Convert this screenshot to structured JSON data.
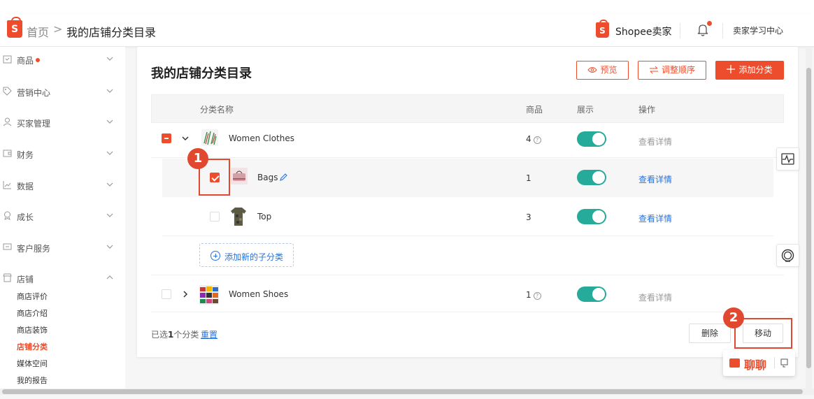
{
  "header": {
    "logo_letter": "S",
    "home": "首页",
    "separator": ">",
    "current": "我的店铺分类目录",
    "seller_logo_letter": "S",
    "seller_name": "Shopee卖家",
    "learning_center": "卖家学习中心",
    "icons": [
      "bell-icon"
    ]
  },
  "sidebar": {
    "items": [
      {
        "label": "商品",
        "icon": "product-icon",
        "has_dot": true
      },
      {
        "label": "营销中心",
        "icon": "tag-icon"
      },
      {
        "label": "买家管理",
        "icon": "user-icon"
      },
      {
        "label": "财务",
        "icon": "wallet-icon"
      },
      {
        "label": "数据",
        "icon": "chart-icon"
      },
      {
        "label": "成长",
        "icon": "badge-icon"
      },
      {
        "label": "客户服务",
        "icon": "message-icon"
      },
      {
        "label": "店铺",
        "icon": "shop-icon"
      }
    ],
    "shop_sub": [
      "商店评价",
      "商店介绍",
      "商店装饰",
      "店铺分类",
      "媒体空间",
      "我的报告"
    ],
    "active_sub": "店铺分类"
  },
  "main": {
    "title": "我的店铺分类目录",
    "buttons": {
      "preview": "预览",
      "reorder": "调整顺序",
      "add": "添加分类"
    },
    "columns": {
      "name": "分类名称",
      "products": "商品",
      "display": "展示",
      "actions": "操作"
    },
    "rows": [
      {
        "name": "Women Clothes",
        "count": "4",
        "count_help": "?",
        "display": true,
        "action": "查看详情",
        "checked": "partial",
        "expanded": true
      },
      {
        "name": "Bags",
        "count": "1",
        "display": true,
        "action": "查看详情",
        "checked": true
      },
      {
        "name": "Top",
        "count": "3",
        "display": true,
        "action": "查看详情",
        "checked": false
      },
      {
        "name": "Women Shoes",
        "count": "1",
        "count_help": "?",
        "display": true,
        "action": "查看详情",
        "checked": false,
        "expanded": false
      }
    ],
    "add_subcategory": "添加新的子分类",
    "footer": {
      "selected_prefix": "已选",
      "selected_count": "1",
      "selected_suffix": "个分类",
      "reset": "重置",
      "delete": "删除",
      "move": "移动"
    }
  },
  "annotations": {
    "badge1": "1",
    "badge2": "2",
    "color": "#e0482f"
  },
  "chat": {
    "label": "聊聊"
  },
  "colors": {
    "brand": "#ee4d2d",
    "toggle_on": "#26aa99",
    "link": "#2673dd"
  }
}
